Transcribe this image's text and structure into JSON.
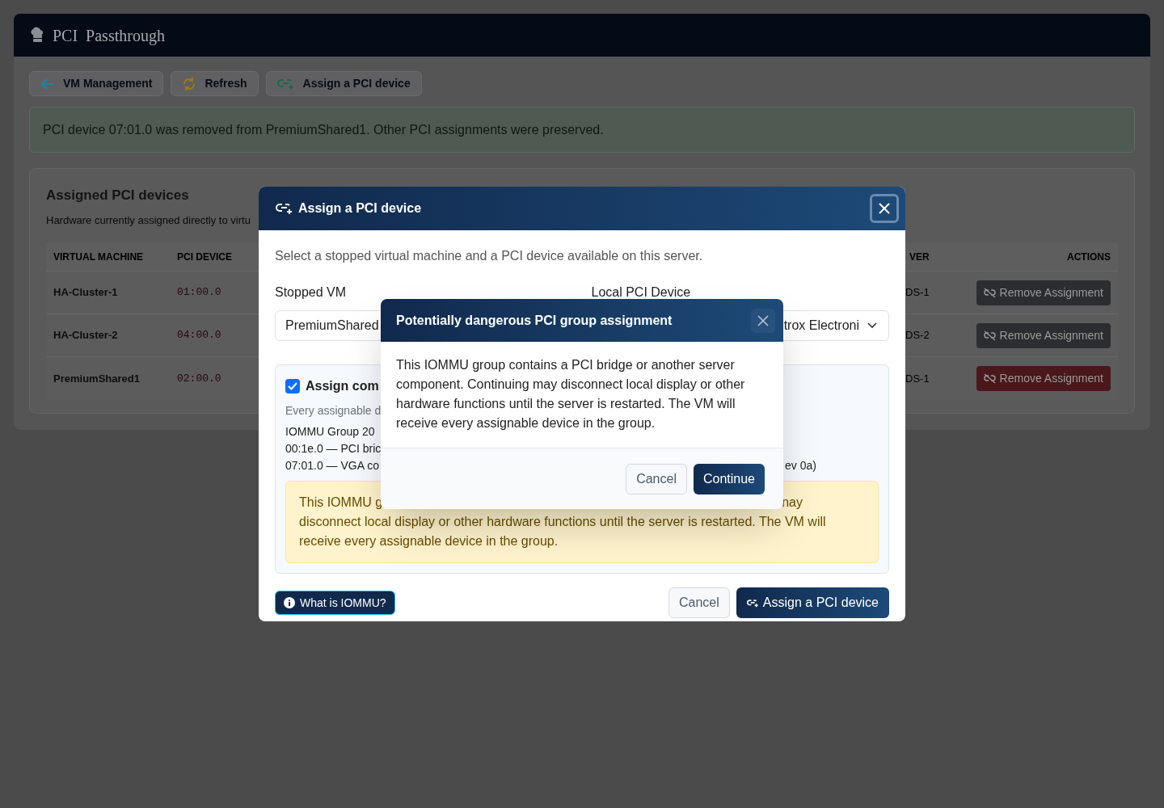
{
  "app_bar": {
    "title": "PCI Passthrough"
  },
  "toolbar": [
    {
      "label": "VM Management"
    },
    {
      "label": "Refresh"
    },
    {
      "label": "Assign a PCI device"
    }
  ],
  "alert": {
    "text": "PCI device 07:01.0 was removed from PremiumShared1. Other PCI assignments were preserved."
  },
  "assigned_card": {
    "title": "Assigned PCI devices",
    "subtitle": "Hardware currently assigned directly to virtu",
    "columns": [
      "VIRTUAL MACHINE",
      "PCI DEVICE",
      "VER",
      "ACTIONS"
    ],
    "rows": [
      {
        "vm": "HA-Cluster-1",
        "device": "01:00.0",
        "column_3": "DS-1",
        "action": "Remove Assignment",
        "color": "#2b2d30"
      },
      {
        "vm": "HA-Cluster-2",
        "device": "04:00.0",
        "column_3": "DS-2",
        "action": "Remove Assignment",
        "color": "#2b2d30"
      },
      {
        "vm": "PremiumShared1",
        "device": "02:00.0",
        "column_3": "DS-1",
        "action": "Remove Assignment",
        "color": "#4a171b"
      }
    ]
  },
  "assign_dialog": {
    "title": "Assign a PCI device",
    "intro": "Select a stopped virtual machine and a PCI device available on this server.",
    "vm_label": "Stopped VM",
    "vm_value": "PremiumShared",
    "device_label": "Local PCI Device",
    "device_value": "trox Electroni",
    "group": {
      "checked": true,
      "label": "Assign com",
      "hint": "Every assignable d",
      "lines": [
        {
          "left": "IOMMU Group 20"
        },
        {
          "left": "00:1e.0 — PCI bric"
        },
        {
          "left": "07:01.0 — VGA co",
          "right": "ev 0a)"
        }
      ],
      "warning": [
        "This IOMMU g",
        "nay",
        "disconnect local display or other hardware functions until the server is restarted. The VM will",
        "receive every assignable device in the group."
      ]
    },
    "help_button": "What is IOMMU?",
    "cancel": "Cancel",
    "submit": "Assign a PCI device"
  },
  "confirm_dialog": {
    "title": "Potentially dangerous PCI group assignment",
    "body": "This IOMMU group contains a PCI bridge or another server component. Continuing may disconnect local display or other hardware functions until the server is restarted. The VM will receive every assignable device in the group.",
    "cancel": "Cancel",
    "confirm": "Continue"
  }
}
